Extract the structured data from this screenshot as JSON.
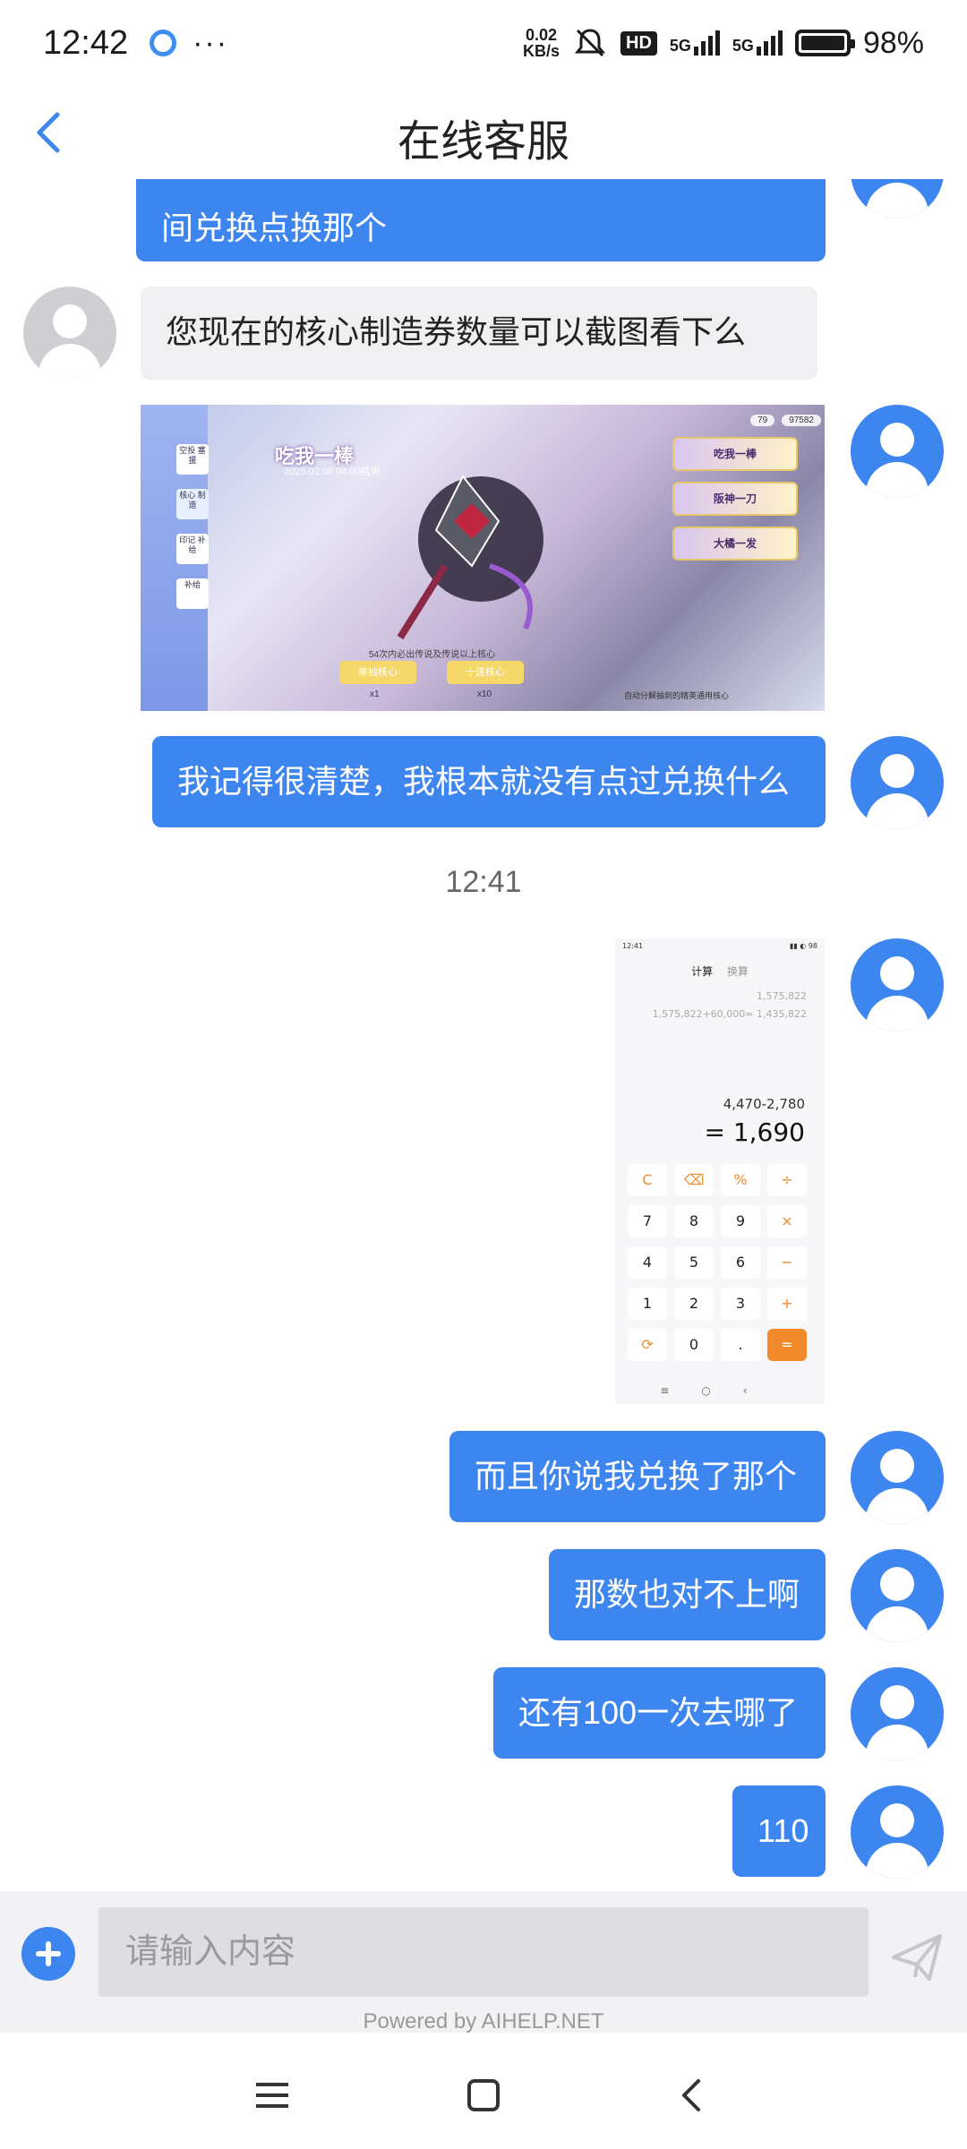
{
  "status_bar": {
    "time": "12:42",
    "dots": "···",
    "net_speed_value": "0.02",
    "net_speed_unit": "KB/s",
    "hd": "HD",
    "network1": "5G",
    "network2": "5G",
    "battery": "98%"
  },
  "header": {
    "title": "在线客服"
  },
  "messages": {
    "m1": "间兑换点换那个",
    "m2": "您现在的核心制造券数量可以截图看下么",
    "m3": "我记得很清楚，我根本就没有点过兑换什么",
    "timestamp": "12:41",
    "m4": "而且你说我兑换了那个",
    "m5": "那数也对不上啊",
    "m6": "还有100一次去哪了",
    "m7": "110"
  },
  "game_screenshot": {
    "tabs": [
      "空投\n塞援",
      "核心\n制造",
      "印记\n补给",
      "补给"
    ],
    "balance1": "79",
    "balance2": "97582",
    "banner_title": "吃我一棒",
    "banner_date": "2025.02.08 04:00结束",
    "side_banners": [
      "吃我一棒",
      "阪神一刀",
      "大橘一发"
    ],
    "pull_buttons": [
      "单抽核心",
      "十连核心"
    ],
    "pull_costs": [
      "x1",
      "x10"
    ],
    "note": "54次内必出传说及传说以上核心",
    "auto_text": "自动分解抽到的精英通用核心"
  },
  "calculator_screenshot": {
    "status_time": "12:41",
    "tabs": [
      "计算",
      "换算"
    ],
    "history1": "1,575,822",
    "history2": "1,575,822+60,000= 1,435,822",
    "expression": "4,470-2,780",
    "result": "= 1,690",
    "keys": [
      "C",
      "⌫",
      "%",
      "÷",
      "7",
      "8",
      "9",
      "×",
      "4",
      "5",
      "6",
      "−",
      "1",
      "2",
      "3",
      "+",
      "⟳",
      "0",
      ".",
      "="
    ]
  },
  "input": {
    "placeholder": "请输入内容"
  },
  "footer": {
    "powered_by": "Powered by AIHELP.NET"
  },
  "colors": {
    "accent": "#3d86f0",
    "agent_bubble": "#f0f0f2",
    "input_bg": "#dedee2"
  }
}
